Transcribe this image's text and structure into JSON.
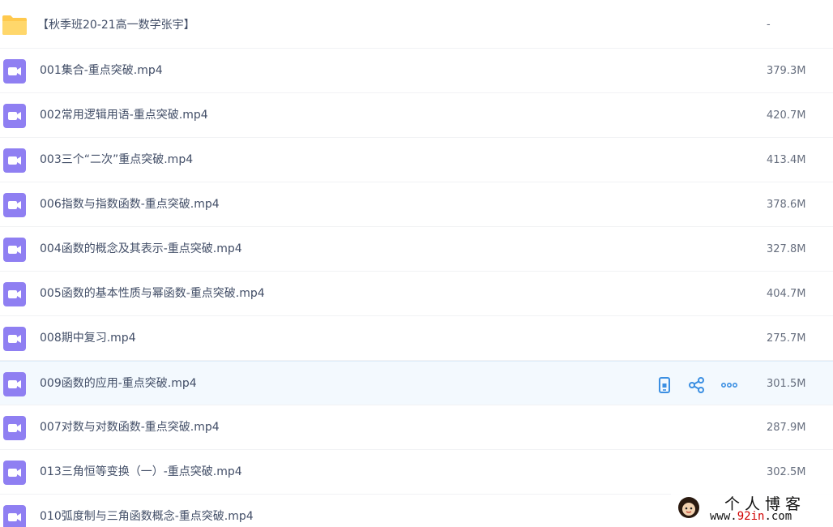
{
  "folder": {
    "name": "【秋季班20-21高一数学张宇】",
    "size": "-",
    "icon": "folder-icon"
  },
  "files": [
    {
      "name": "001集合-重点突破.mp4",
      "size": "379.3M"
    },
    {
      "name": "002常用逻辑用语-重点突破.mp4",
      "size": "420.7M"
    },
    {
      "name": "003三个“二次”重点突破.mp4",
      "size": "413.4M"
    },
    {
      "name": "006指数与指数函数-重点突破.mp4",
      "size": "378.6M"
    },
    {
      "name": "004函数的概念及其表示-重点突破.mp4",
      "size": "327.8M"
    },
    {
      "name": "005函数的基本性质与幂函数-重点突破.mp4",
      "size": "404.7M"
    },
    {
      "name": "008期中复习.mp4",
      "size": "275.7M"
    },
    {
      "name": "009函数的应用-重点突破.mp4",
      "size": "301.5M"
    },
    {
      "name": "007对数与对数函数-重点突破.mp4",
      "size": "287.9M"
    },
    {
      "name": "013三角恒等变换（一）-重点突破.mp4",
      "size": "302.5M"
    },
    {
      "name": "010弧度制与三角函数概念-重点突破.mp4",
      "size": ""
    }
  ],
  "hover_row_index": 7,
  "row_actions": [
    {
      "icon": "phone-icon",
      "name": "send-to-phone-button"
    },
    {
      "icon": "share-icon",
      "name": "share-button"
    },
    {
      "icon": "more-icon",
      "name": "more-button"
    }
  ],
  "colors": {
    "video_icon": "#8f7ff2",
    "folder_icon": "#ffc94d",
    "action_icon": "#3b8fe2",
    "text": "#424e67",
    "hover_bg": "#f3f9fe"
  },
  "watermark": {
    "title": "个人博客",
    "url_prefix": "www.",
    "url_highlight": "92in",
    "url_suffix": ".com"
  }
}
